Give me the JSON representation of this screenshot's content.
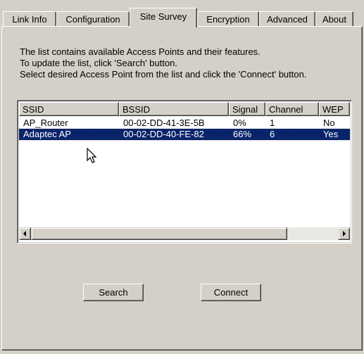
{
  "tabs": [
    {
      "label": "Link Info"
    },
    {
      "label": "Configuration"
    },
    {
      "label": "Site Survey",
      "active": true
    },
    {
      "label": "Encryption"
    },
    {
      "label": "Advanced"
    },
    {
      "label": "About"
    }
  ],
  "description": {
    "line1": "The list contains available Access Points and their features.",
    "line2": "To update the list, click 'Search' button.",
    "line3": "Select desired Access Point from the list and click the 'Connect' button."
  },
  "list": {
    "columns": [
      "SSID",
      "BSSID",
      "Signal",
      "Channel",
      "WEP"
    ],
    "rows": [
      {
        "ssid": "AP_Router",
        "bssid": "00-02-DD-41-3E-5B",
        "signal": "0%",
        "channel": "1",
        "wep": "No",
        "selected": false
      },
      {
        "ssid": "Adaptec AP",
        "bssid": "00-02-DD-40-FE-82",
        "signal": "66%",
        "channel": "6",
        "wep": "Yes",
        "selected": true
      }
    ]
  },
  "buttons": {
    "search": "Search",
    "connect": "Connect"
  },
  "colors": {
    "face": "#d4d0c8",
    "selection": "#0a246a"
  }
}
